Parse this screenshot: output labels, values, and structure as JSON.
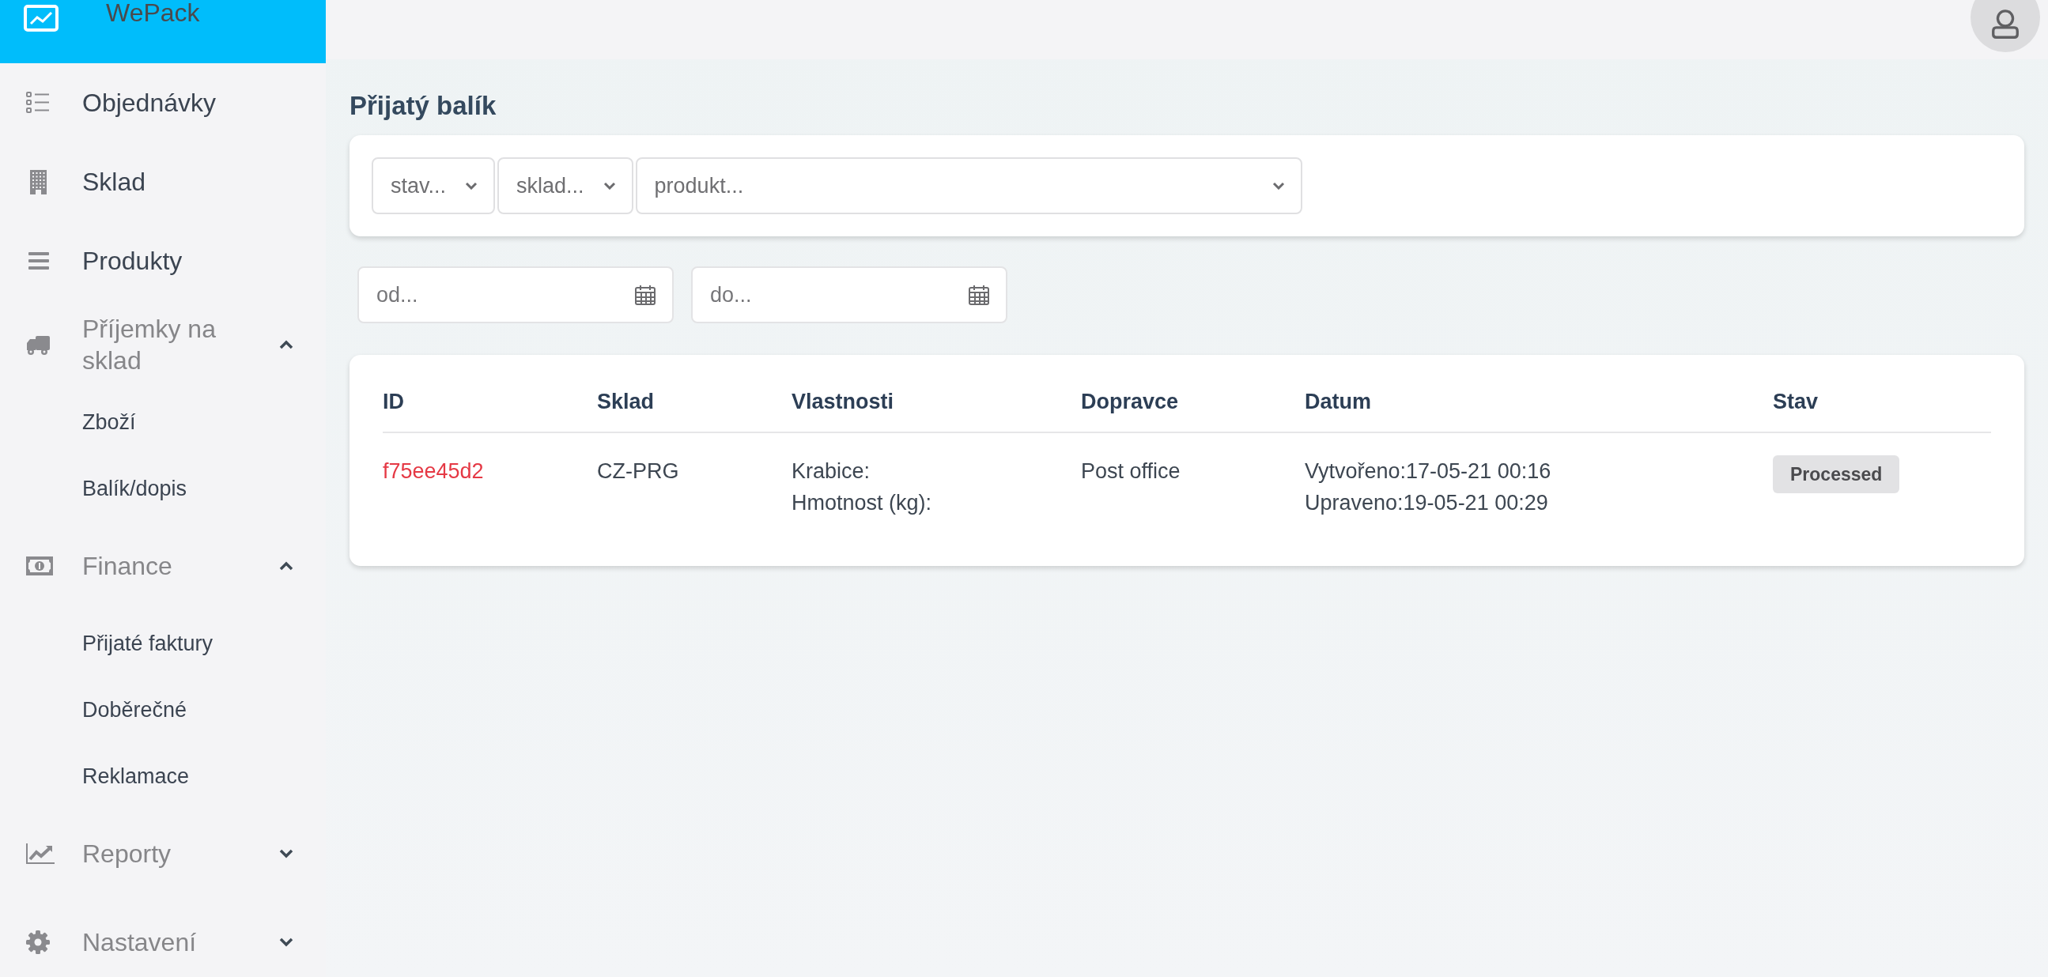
{
  "sidebar": {
    "brand": "WePack",
    "items": [
      {
        "kind": "link",
        "label": "Objednávky"
      },
      {
        "kind": "link",
        "label": "Sklad"
      },
      {
        "kind": "link",
        "label": "Produkty"
      },
      {
        "kind": "group",
        "label": "Příjemky na sklad",
        "expanded": true,
        "children": [
          {
            "label": "Zboží"
          },
          {
            "label": "Balík/dopis"
          }
        ]
      },
      {
        "kind": "group",
        "label": "Finance",
        "expanded": true,
        "children": [
          {
            "label": "Přijaté faktury"
          },
          {
            "label": "Doběrečné"
          },
          {
            "label": "Reklamace"
          }
        ]
      },
      {
        "kind": "group",
        "label": "Reporty",
        "expanded": false
      },
      {
        "kind": "group",
        "label": "Nastavení",
        "expanded": false
      }
    ]
  },
  "page_title": "Přijatý balík",
  "filters": {
    "selects": [
      {
        "placeholder": "stav..."
      },
      {
        "placeholder": "sklad..."
      },
      {
        "placeholder": "produkt..."
      }
    ],
    "dates": [
      {
        "placeholder": "od..."
      },
      {
        "placeholder": "do..."
      }
    ]
  },
  "table": {
    "columns": [
      "ID",
      "Sklad",
      "Vlastnosti",
      "Dopravce",
      "Datum",
      "Stav"
    ],
    "rows": [
      {
        "id": "f75ee45d2",
        "sklad": "CZ-PRG",
        "vlastnosti": [
          "Krabice:",
          "Hmotnost (kg):"
        ],
        "dopravce": "Post office",
        "datum": [
          "Vytvořeno:17-05-21 00:16",
          "Upraveno:19-05-21 00:29"
        ],
        "stav": "Processed"
      }
    ]
  }
}
